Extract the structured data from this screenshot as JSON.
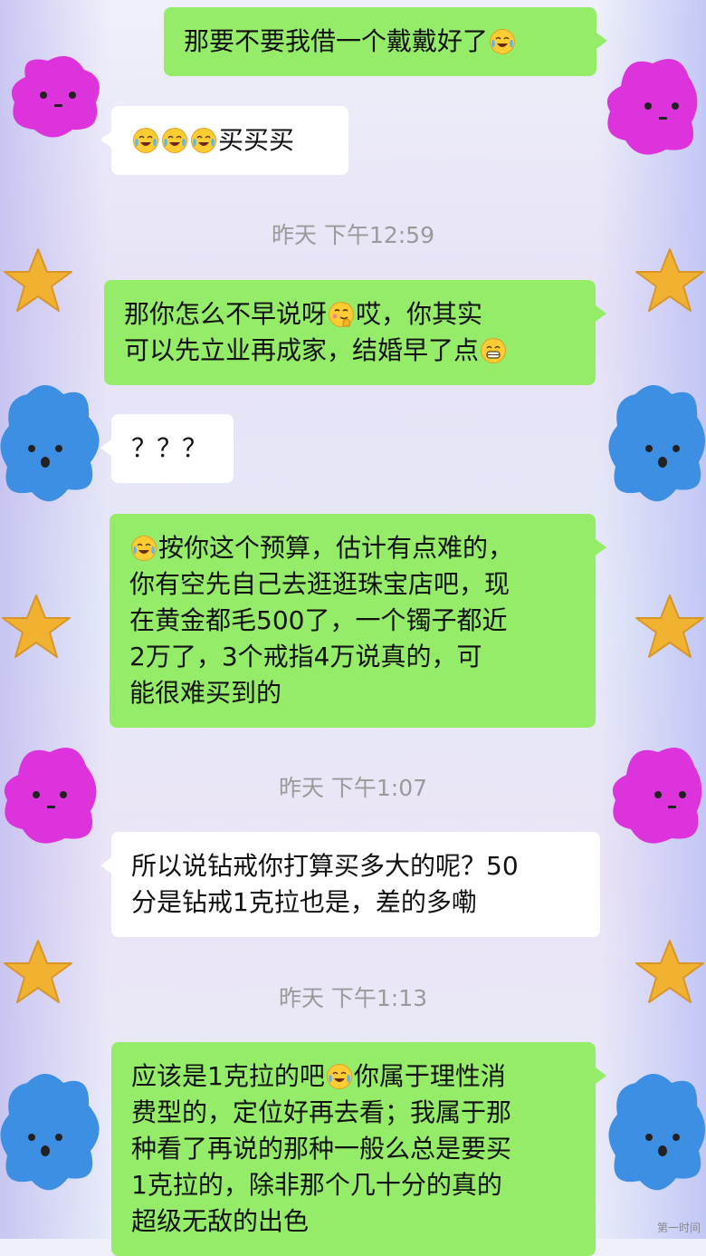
{
  "messages": [
    {
      "side": "out",
      "lines": [
        "那要不要我借一个戴戴好了{cry}"
      ]
    },
    {
      "side": "in",
      "lines": [
        "{cry}{cry}{cry}买买买"
      ]
    },
    {
      "side": "out",
      "lines": [
        "那你怎么不早说呀{shy}哎，你其实",
        "可以先立业再成家，结婚早了点{grin}"
      ]
    },
    {
      "side": "in",
      "lines": [
        "？？？"
      ]
    },
    {
      "side": "out",
      "lines": [
        "{cry}按你这个预算，估计有点难的，",
        "你有空先自己去逛逛珠宝店吧，现",
        "在黄金都毛500了，一个镯子都近",
        "2万了，3个戒指4万说真的，可",
        "能很难买到的"
      ]
    },
    {
      "side": "in",
      "lines": [
        "所以说钻戒你打算买多大的呢？50",
        "分是钻戒1克拉也是，差的多嘞"
      ]
    },
    {
      "side": "out",
      "lines": [
        "应该是1克拉的吧{cry}你属于理性消",
        "费型的，定位好再去看；我属于那",
        "种看了再说的那种一般么总是要买",
        "1克拉的，除非那个几十分的真的",
        "超级无敌的出色"
      ]
    }
  ],
  "timestamps": [
    "昨天 下午12:59",
    "昨天 下午1:07",
    "昨天 下午1:13"
  ],
  "icons": {
    "cry": "laughing-crying-emoji",
    "shy": "shy-emoji",
    "grin": "grinning-emoji"
  },
  "colors": {
    "outgoing_bubble": "#95ec69",
    "incoming_bubble": "#ffffff",
    "timestamp": "#9a9a9a"
  },
  "watermark": "第一时间"
}
